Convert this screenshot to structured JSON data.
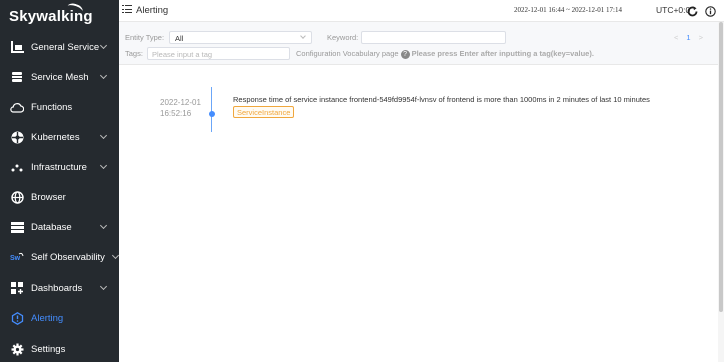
{
  "sidebar": {
    "logo": "Skywalking",
    "items": [
      {
        "label": "General Service",
        "icon": "bar-chart-icon",
        "chevron": true
      },
      {
        "label": "Service Mesh",
        "icon": "layers-icon",
        "chevron": true
      },
      {
        "label": "Functions",
        "icon": "cloud-icon",
        "chevron": false
      },
      {
        "label": "Kubernetes",
        "icon": "kubernetes-icon",
        "chevron": true
      },
      {
        "label": "Infrastructure",
        "icon": "dots-icon",
        "chevron": true
      },
      {
        "label": "Browser",
        "icon": "globe-icon",
        "chevron": false
      },
      {
        "label": "Database",
        "icon": "database-icon",
        "chevron": true
      },
      {
        "label": "Self Observability",
        "icon": "sw-icon",
        "chevron": true
      },
      {
        "label": "Dashboards",
        "icon": "dashboard-icon",
        "chevron": true
      },
      {
        "label": "Alerting",
        "icon": "alert-icon",
        "chevron": false,
        "active": true
      },
      {
        "label": "Settings",
        "icon": "gear-icon",
        "chevron": false
      }
    ]
  },
  "header": {
    "title": "Alerting",
    "time_range": "2022-12-01 16:44 ~ 2022-12-01 17:14",
    "timezone": "UTC+0:0"
  },
  "toolbar": {
    "entity_type_label": "Entity Type:",
    "entity_type_value": "All",
    "keyword_label": "Keyword:",
    "keyword_value": "",
    "tags_label": "Tags:",
    "tags_placeholder": "Please input a tag",
    "vocab_label": "Configuration Vocabulary page",
    "help_text": "Please press Enter after inputting a tag(key=value).",
    "pager_prev": "<",
    "pager_page": "1",
    "pager_next": ">"
  },
  "alarms": [
    {
      "date": "2022-12-01",
      "time": "16:52:16",
      "message": "Response time of service instance frontend-549fd9954f-lvnsv of frontend is more than 1000ms in 2 minutes of last 10 minutes",
      "tag": "ServiceInstance"
    }
  ],
  "colors": {
    "sidebar_bg": "#252a2f",
    "accent": "#448dfe",
    "tag": "#f0a73d"
  }
}
